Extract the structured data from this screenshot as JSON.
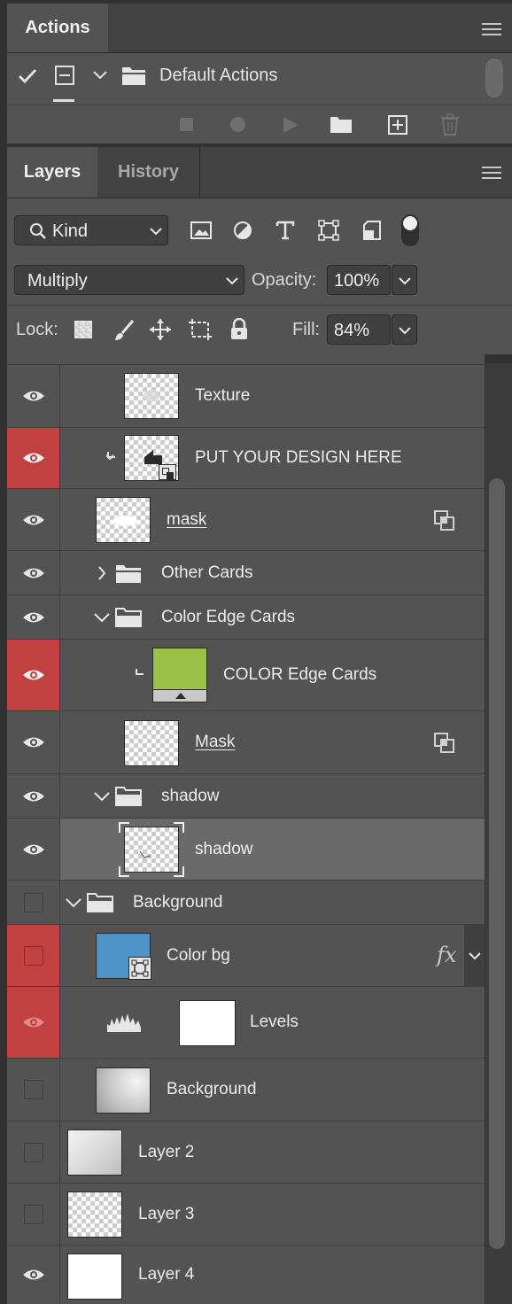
{
  "actions_panel": {
    "tab_label": "Actions",
    "set_name": "Default Actions",
    "toolbar_icons": [
      "stop-icon",
      "record-icon",
      "play-icon",
      "new-set-folder-icon",
      "new-action-icon",
      "trash-icon"
    ]
  },
  "layers_panel": {
    "tabs": [
      {
        "label": "Layers",
        "active": true
      },
      {
        "label": "History",
        "active": false
      }
    ],
    "filter": {
      "label": "Kind",
      "icons": [
        "image-filter-icon",
        "adjustment-filter-icon",
        "type-filter-icon",
        "shape-filter-icon",
        "smart-object-filter-icon",
        "filter-toggle-icon"
      ]
    },
    "blend_mode": "Multiply",
    "opacity_label": "Opacity:",
    "opacity_value": "100%",
    "lock_label": "Lock:",
    "fill_label": "Fill:",
    "fill_value": "84%",
    "layers": [
      {
        "name": "Texture",
        "visible": true,
        "red": false
      },
      {
        "name": "PUT YOUR DESIGN HERE",
        "visible": true,
        "red": true
      },
      {
        "name": "mask",
        "visible": true,
        "red": false
      },
      {
        "name": "Other Cards",
        "visible": true,
        "red": false
      },
      {
        "name": "Color Edge Cards",
        "visible": true,
        "red": false
      },
      {
        "name": "COLOR Edge Cards",
        "visible": true,
        "red": true
      },
      {
        "name": "Mask",
        "visible": true,
        "red": false
      },
      {
        "name": "shadow",
        "visible": true,
        "red": false
      },
      {
        "name": "shadow",
        "visible": true,
        "red": false,
        "selected": true
      },
      {
        "name": "Background",
        "visible": false,
        "red": false
      },
      {
        "name": "Color bg",
        "visible": false,
        "red": true,
        "fx": "fx"
      },
      {
        "name": "Levels",
        "visible": true,
        "red": true
      },
      {
        "name": "Background",
        "visible": false,
        "red": false
      },
      {
        "name": "Layer 2",
        "visible": false,
        "red": false
      },
      {
        "name": "Layer 3",
        "visible": false,
        "red": false
      },
      {
        "name": "Layer 4",
        "visible": true,
        "red": false
      }
    ]
  },
  "colors": {
    "panel": "#535353",
    "highlight_red": "#c14141",
    "selected_row": "#6a6a6a",
    "green_fill": "#9bc247",
    "blue_fill": "#4e94c8"
  }
}
